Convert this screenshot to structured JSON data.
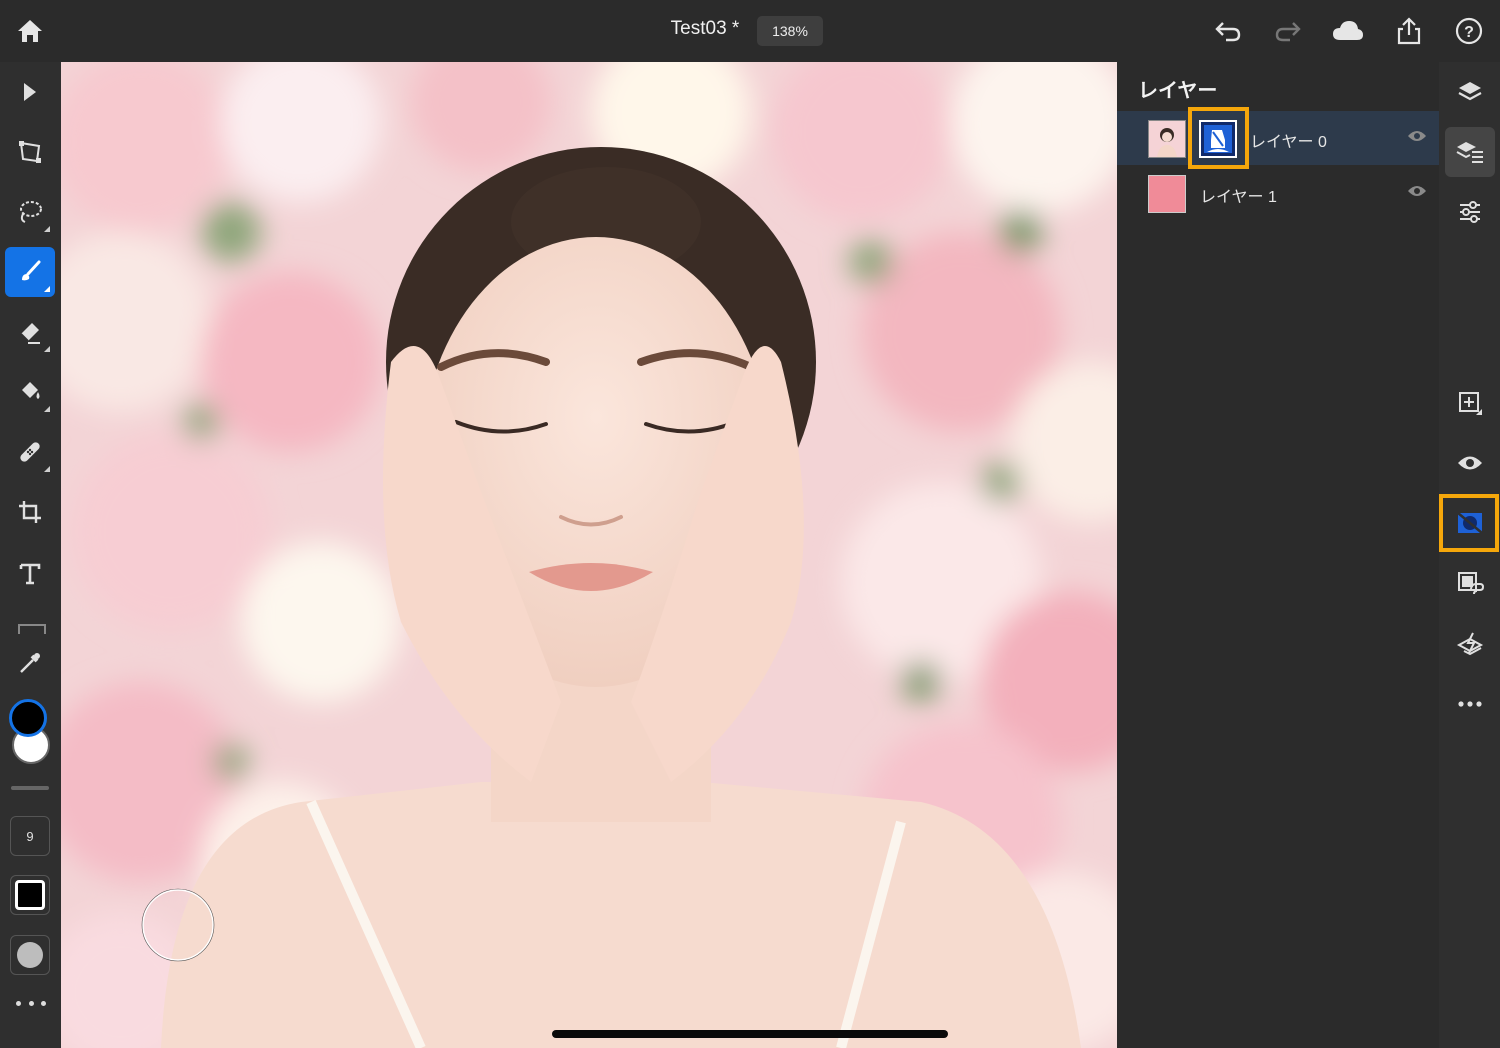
{
  "topbar": {
    "doc_title": "Test03 *",
    "zoom": "138%",
    "icons": [
      "home-icon",
      "undo-icon",
      "redo-icon",
      "cloud-icon",
      "share-icon",
      "help-icon"
    ]
  },
  "left_toolbar": {
    "tools": [
      "select-tool",
      "transform-tool",
      "lasso-tool",
      "brush-tool",
      "eraser-tool",
      "fill-tool",
      "healing-tool",
      "crop-tool",
      "type-tool",
      "eyedropper-tool"
    ],
    "active_tool": "brush-tool",
    "brush_size": "9",
    "foreground_color": "#000000",
    "background_color": "#ffffff"
  },
  "layers_panel": {
    "title": "レイヤー",
    "layers": [
      {
        "name": "レイヤー 0",
        "selected": true,
        "visible": true,
        "has_mask": true
      },
      {
        "name": "レイヤー 1",
        "selected": false,
        "visible": true,
        "fill_color": "#f08b98"
      }
    ]
  },
  "right_rail": {
    "buttons": [
      "layers-icon",
      "layer-properties-icon",
      "adjustments-icon",
      "add-layer-icon",
      "visibility-icon",
      "mask-icon",
      "clipping-mask-icon",
      "merge-layer-icon",
      "more-icon"
    ],
    "active": "layer-properties-icon",
    "highlighted": "mask-icon"
  },
  "colors": {
    "accent": "#1473e6",
    "highlight": "#f5a70b",
    "panel_bg": "#2b2b2b"
  }
}
